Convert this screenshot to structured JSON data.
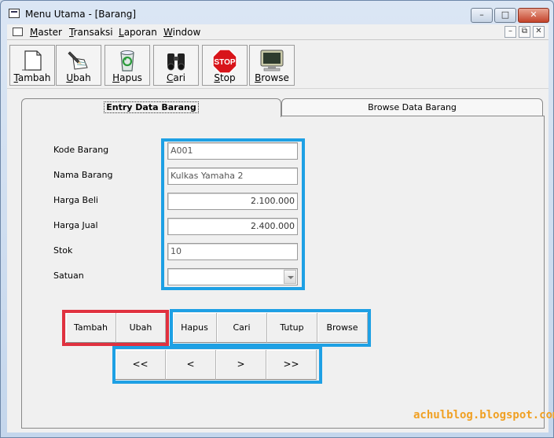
{
  "window": {
    "title": "Menu Utama - [Barang]",
    "min": "–",
    "max": "□",
    "close": "✕"
  },
  "menubar": {
    "items": [
      {
        "hot": "M",
        "rest": "aster"
      },
      {
        "hot": "T",
        "rest": "ransaksi"
      },
      {
        "hot": "L",
        "rest": "aporan"
      },
      {
        "hot": "W",
        "rest": "indow"
      }
    ],
    "mdi": {
      "min": "–",
      "restore": "⧉",
      "close": "✕"
    }
  },
  "toolbar": {
    "buttons": [
      {
        "hot": "T",
        "rest": "ambah",
        "icon": "new-document-icon"
      },
      {
        "hot": "U",
        "rest": "bah",
        "icon": "edit-pencil-icon"
      },
      {
        "hot": "H",
        "rest": "apus",
        "icon": "recycle-bin-icon"
      },
      {
        "hot": "C",
        "rest": "ari",
        "icon": "binoculars-icon"
      },
      {
        "hot": "S",
        "rest": "top",
        "icon": "stop-sign-icon"
      },
      {
        "hot": "B",
        "rest": "rowse",
        "icon": "monitor-icon"
      }
    ],
    "stop_sign_text": "STOP"
  },
  "tabs": [
    {
      "label": "Entry Data Barang",
      "active": true
    },
    {
      "label": "Browse Data Barang",
      "active": false
    }
  ],
  "form": {
    "kode": {
      "label": "Kode Barang",
      "value": "A001"
    },
    "nama": {
      "label": "Nama Barang",
      "value": "Kulkas Yamaha 2"
    },
    "beli": {
      "label": "Harga Beli",
      "value": "2.100.000"
    },
    "jual": {
      "label": "Harga Jual",
      "value": "2.400.000"
    },
    "stok": {
      "label": "Stok",
      "value": "10"
    },
    "satuan": {
      "label": "Satuan",
      "value": ""
    }
  },
  "actions": {
    "tambah": "Tambah",
    "ubah": "Ubah",
    "hapus": "Hapus",
    "cari": "Cari",
    "tutup": "Tutup",
    "browse": "Browse"
  },
  "nav": {
    "first": "<<",
    "prev": "<",
    "next": ">",
    "last": ">>"
  },
  "watermark": "achulblog.blogspot.com",
  "colors": {
    "highlight_blue": "#1ea0e4",
    "highlight_red": "#e0313f",
    "watermark": "#f0a023"
  }
}
